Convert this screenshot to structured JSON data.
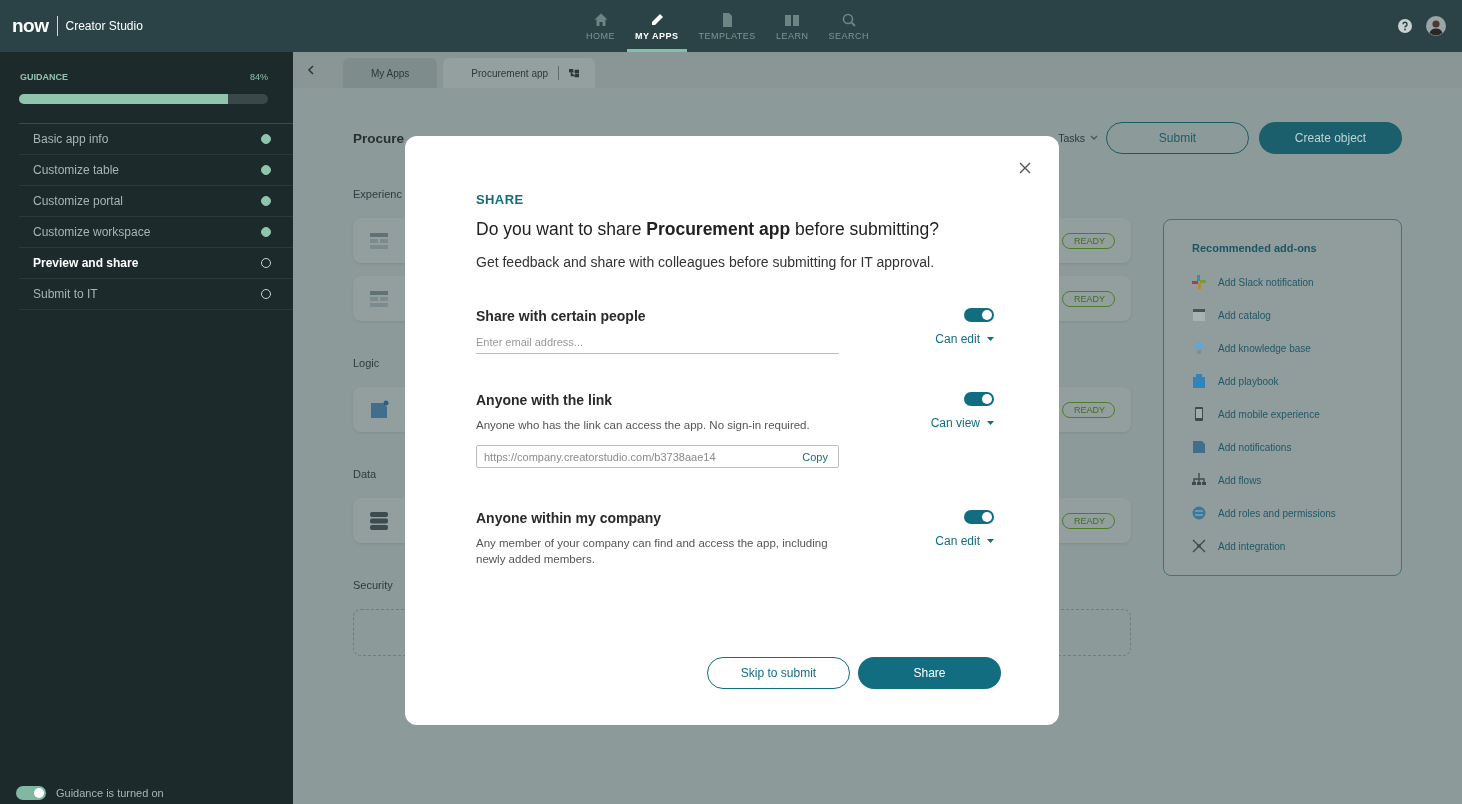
{
  "topbar": {
    "logo": "now",
    "product": "Creator Studio",
    "nav": [
      {
        "label": "HOME",
        "selected": false
      },
      {
        "label": "MY APPS",
        "selected": true
      },
      {
        "label": "TEMPLATES",
        "selected": false
      },
      {
        "label": "LEARN",
        "selected": false
      },
      {
        "label": "SEARCH",
        "selected": false
      }
    ]
  },
  "sidebar": {
    "title": "GUIDANCE",
    "percent": "84%",
    "level": 0.84,
    "steps": [
      {
        "label": "Basic app info",
        "done": true,
        "selected": false
      },
      {
        "label": "Customize table",
        "done": true,
        "selected": false
      },
      {
        "label": "Customize portal",
        "done": true,
        "selected": false
      },
      {
        "label": "Customize workspace",
        "done": true,
        "selected": false
      },
      {
        "label": "Preview and share",
        "done": false,
        "selected": true
      },
      {
        "label": "Submit to IT",
        "done": false,
        "selected": false
      }
    ],
    "guidance_toggle": {
      "label": "Guidance is turned on",
      "on": true
    }
  },
  "tabs": [
    {
      "label": "My Apps",
      "selected": false
    },
    {
      "label": "Procurement app",
      "selected": true
    }
  ],
  "page": {
    "heading": "Procure",
    "tasks": "Tasks",
    "actions": [
      {
        "label": "Submit",
        "kind": "secondary"
      },
      {
        "label": "Create object",
        "kind": "primary"
      }
    ],
    "sections": [
      {
        "label": "Experienc",
        "kind": "cards",
        "cards": [
          {
            "status": "READY"
          },
          {
            "status": "READY"
          }
        ]
      },
      {
        "label": "Logic",
        "kind": "cards",
        "cards": [
          {
            "status": "READY"
          }
        ]
      },
      {
        "label": "Data",
        "kind": "cards",
        "cards": [
          {
            "status": "READY"
          }
        ]
      },
      {
        "label": "Security",
        "kind": "dropzone"
      }
    ],
    "addons": {
      "title": "Recommended add-ons",
      "items": [
        "Add Slack notification",
        "Add catalog",
        "Add knowledge base",
        "Add playbook",
        "Add mobile experience",
        "Add notifications",
        "Add flows",
        "Add roles and permissions",
        "Add integration"
      ]
    }
  },
  "modal": {
    "eyebrow": "SHARE",
    "title": "Do you want to share **Procurement app** before submitting?",
    "subtitle": "Get feedback and share with colleagues before submitting for IT approval.",
    "options": [
      {
        "kind": "email",
        "title": "Share with certain people",
        "on": true,
        "permission": "Can edit",
        "placeholder": "Enter email address..."
      },
      {
        "kind": "link",
        "title": "Anyone with the link",
        "on": true,
        "permission": "Can view",
        "description": "Anyone who has the link can access the app. No sign-in required.",
        "url": "https://company.creatorstudio.com/b3738aae14",
        "copy": "Copy"
      },
      {
        "kind": "plain",
        "title": "Anyone within my company",
        "on": true,
        "permission": "Can edit",
        "description": "Any member of your company can find and access the app, including newly added members."
      }
    ],
    "buttons": [
      {
        "label": "Skip to submit",
        "kind": "secondary"
      },
      {
        "label": "Share",
        "kind": "primary"
      }
    ]
  }
}
